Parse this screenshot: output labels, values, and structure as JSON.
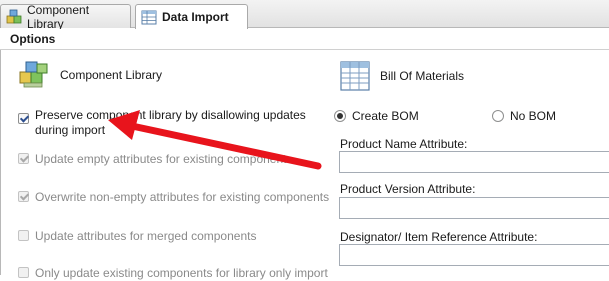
{
  "tabs": [
    {
      "label": "Component Library"
    },
    {
      "label": "Data Import"
    }
  ],
  "options_title": "Options",
  "component_library": {
    "title": "Component Library",
    "checkboxes": [
      {
        "label_line1": "Preserve component library by disallowing updates",
        "label_line2": "during import",
        "checked": true,
        "enabled": true
      },
      {
        "label": "Update empty attributes for existing components",
        "checked": true,
        "enabled": false
      },
      {
        "label": "Overwrite non-empty attributes for existing components",
        "checked": true,
        "enabled": false
      },
      {
        "label": "Update attributes for merged components",
        "checked": false,
        "enabled": false
      },
      {
        "label": "Only update existing components for library only import",
        "checked": false,
        "enabled": false
      }
    ]
  },
  "bom": {
    "title": "Bill Of Materials",
    "radio_create": "Create BOM",
    "radio_none": "No BOM",
    "selected": "Create BOM",
    "product_name_label": "Product Name Attribute:",
    "product_name_value": "",
    "product_version_label": "Product Version Attribute:",
    "product_version_value": "",
    "designator_label": "Designator/ Item Reference Attribute:",
    "designator_value": ""
  },
  "annotation_color": "#e8141c"
}
